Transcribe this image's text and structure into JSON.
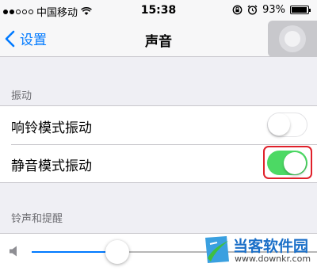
{
  "status": {
    "carrier": "中国移动",
    "time": "15:38",
    "battery": "93%",
    "battery_level": 0.93,
    "signal_bars": 2
  },
  "nav": {
    "back_label": "设置",
    "title": "声音"
  },
  "sections": {
    "vibrate": {
      "header": "振动",
      "rows": [
        {
          "label": "响铃模式振动",
          "on": false
        },
        {
          "label": "静音模式振动",
          "on": true
        }
      ]
    },
    "ringer": {
      "header": "铃声和提醒",
      "volume_level": 0.3
    }
  },
  "colors": {
    "accent": "#007aff",
    "switch_on": "#4cd964",
    "highlight": "#e0202a"
  },
  "watermark": {
    "title": "当客软件园",
    "url": "www.downkr.com"
  }
}
